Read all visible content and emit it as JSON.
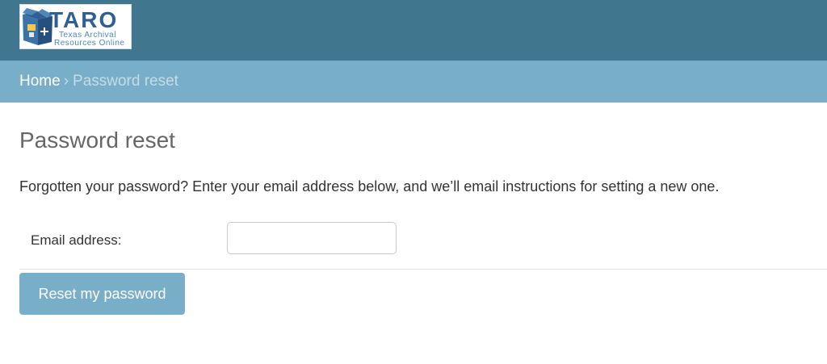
{
  "header": {
    "logo": {
      "icon": "archive-box-logo-icon",
      "title": "TARO",
      "subtitle_line1": "Texas Archival",
      "subtitle_line2": "Resources Online"
    }
  },
  "breadcrumbs": {
    "home_label": "Home",
    "separator": "›",
    "current_label": "Password reset"
  },
  "main": {
    "title": "Password reset",
    "intro_text": "Forgotten your password? Enter your email address below, and we’ll email instructions for setting a new one.",
    "form": {
      "email_label": "Email address:",
      "email_value": "",
      "email_placeholder": "",
      "submit_label": "Reset my password"
    }
  },
  "colors": {
    "header_bg": "#41768f",
    "breadcrumb_bg": "#79aec8",
    "button_bg": "#79aec8",
    "title_text": "#666666",
    "body_text": "#333333"
  }
}
